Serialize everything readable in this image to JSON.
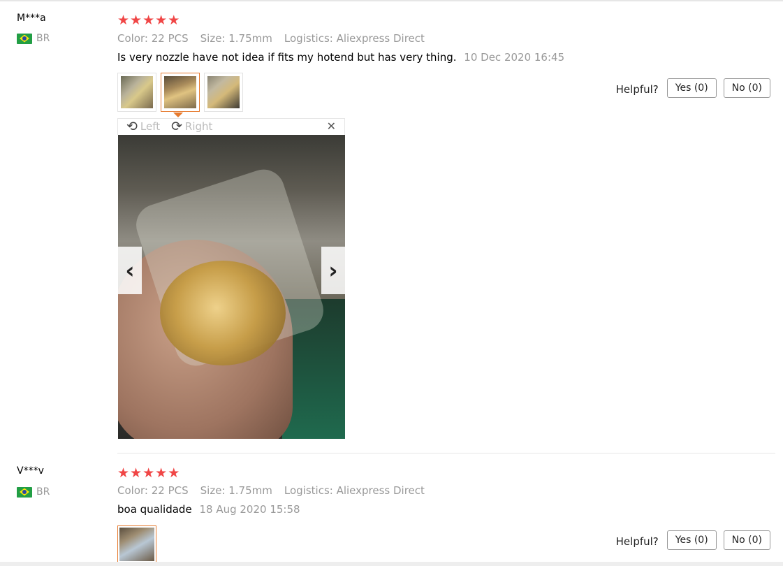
{
  "reviews": [
    {
      "user": "M***a",
      "country": "BR",
      "stars": [
        "★",
        "★",
        "★",
        "★",
        "★"
      ],
      "meta": {
        "color": "Color: 22 PCS",
        "size": "Size: 1.75mm",
        "logistics": "Logistics: Aliexpress Direct"
      },
      "content": "Is very nozzle have not idea if fits my hotend but has very thing.",
      "date": "10 Dec 2020 16:45",
      "viewer": {
        "rotate_left": "Left",
        "rotate_right": "Right",
        "close": "✕",
        "prev": "‹",
        "next": "›"
      },
      "helpful": {
        "label": "Helpful?",
        "yes": "Yes (0)",
        "no": "No (0)"
      }
    },
    {
      "user": "V***v",
      "country": "BR",
      "stars": [
        "★",
        "★",
        "★",
        "★",
        "★"
      ],
      "meta": {
        "color": "Color: 22 PCS",
        "size": "Size: 1.75mm",
        "logistics": "Logistics: Aliexpress Direct"
      },
      "content": "boa qualidade",
      "date": "18 Aug 2020 15:58",
      "helpful": {
        "label": "Helpful?",
        "yes": "Yes (0)",
        "no": "No (0)"
      }
    }
  ],
  "colors": {
    "star": "#f04646",
    "active_thumb": "#e67a2e",
    "muted": "#999999"
  }
}
